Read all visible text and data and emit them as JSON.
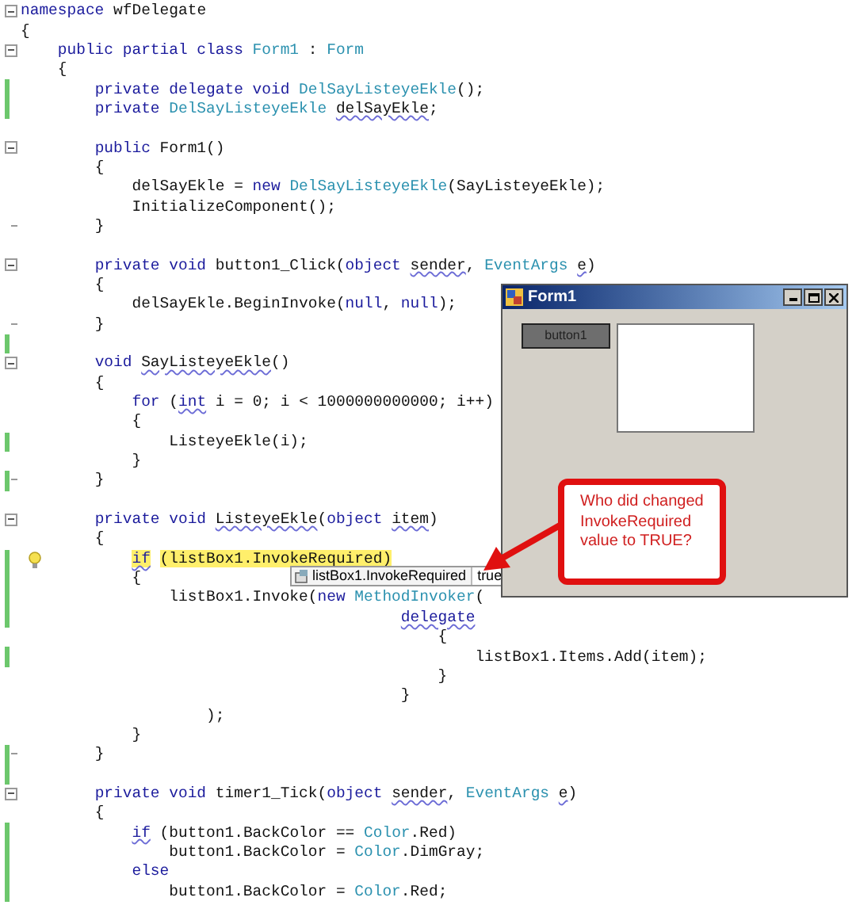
{
  "editor": {
    "lines": [
      {
        "fold": true,
        "end": false,
        "changed": false,
        "tokens": [
          {
            "t": "namespace",
            "kind": "kw"
          },
          {
            "t": " wfDelegate",
            "kind": "plain"
          }
        ]
      },
      {
        "fold": false,
        "end": false,
        "changed": false,
        "tokens": [
          {
            "t": "{",
            "kind": "plain"
          }
        ]
      },
      {
        "fold": true,
        "end": false,
        "changed": false,
        "tokens": [
          {
            "t": "    public partial class ",
            "kind": "kw"
          },
          {
            "t": "Form1",
            "kind": "type"
          },
          {
            "t": " : ",
            "kind": "plain"
          },
          {
            "t": "Form",
            "kind": "type"
          }
        ]
      },
      {
        "fold": false,
        "end": false,
        "changed": false,
        "tokens": [
          {
            "t": "    {",
            "kind": "plain"
          }
        ]
      },
      {
        "fold": false,
        "end": false,
        "changed": true,
        "tokens": [
          {
            "t": "        private delegate void ",
            "kind": "kw"
          },
          {
            "t": "DelSayListeyeEkle",
            "kind": "type"
          },
          {
            "t": "();",
            "kind": "plain"
          }
        ]
      },
      {
        "fold": false,
        "end": false,
        "changed": true,
        "tokens": [
          {
            "t": "        private ",
            "kind": "kw"
          },
          {
            "t": "DelSayListeyeEkle ",
            "kind": "type"
          },
          {
            "t": "delSayEkle",
            "kind": "warn"
          },
          {
            "t": ";",
            "kind": "plain"
          }
        ]
      },
      {
        "fold": false,
        "end": false,
        "changed": false
      },
      {
        "fold": true,
        "end": false,
        "changed": false,
        "tokens": [
          {
            "t": "        public ",
            "kind": "kw"
          },
          {
            "t": "Form1()",
            "kind": "plain"
          }
        ]
      },
      {
        "fold": false,
        "end": false,
        "changed": false,
        "tokens": [
          {
            "t": "        {",
            "kind": "plain"
          }
        ]
      },
      {
        "fold": false,
        "end": false,
        "changed": false,
        "tokens": [
          {
            "t": "            delSayEkle = ",
            "kind": "plain"
          },
          {
            "t": "new ",
            "kind": "kw"
          },
          {
            "t": "DelSayListeyeEkle",
            "kind": "type"
          },
          {
            "t": "(SayListeyeEkle);",
            "kind": "plain"
          }
        ]
      },
      {
        "fold": false,
        "end": false,
        "changed": false,
        "tokens": [
          {
            "t": "            InitializeComponent();",
            "kind": "plain"
          }
        ]
      },
      {
        "fold": false,
        "end": true,
        "changed": false,
        "tokens": [
          {
            "t": "        }",
            "kind": "plain"
          }
        ]
      },
      {
        "fold": false,
        "end": false,
        "changed": false
      },
      {
        "fold": true,
        "end": false,
        "changed": false,
        "tokens": [
          {
            "t": "        private void ",
            "kind": "kw"
          },
          {
            "t": "button1_Click(",
            "kind": "plain"
          },
          {
            "t": "object ",
            "kind": "kw"
          },
          {
            "t": "sender",
            "kind": "warn"
          },
          {
            "t": ", ",
            "kind": "plain"
          },
          {
            "t": "EventArgs ",
            "kind": "type"
          },
          {
            "t": "e",
            "kind": "warn"
          },
          {
            "t": ")",
            "kind": "plain"
          }
        ]
      },
      {
        "fold": false,
        "end": false,
        "changed": false,
        "tokens": [
          {
            "t": "        {",
            "kind": "plain"
          }
        ]
      },
      {
        "fold": false,
        "end": false,
        "changed": false,
        "tokens": [
          {
            "t": "            delSayEkle.BeginInvoke(",
            "kind": "plain"
          },
          {
            "t": "null",
            "kind": "kw"
          },
          {
            "t": ", ",
            "kind": "plain"
          },
          {
            "t": "null",
            "kind": "kw"
          },
          {
            "t": ");",
            "kind": "plain"
          }
        ]
      },
      {
        "fold": false,
        "end": true,
        "changed": false,
        "tokens": [
          {
            "t": "        }",
            "kind": "plain"
          }
        ]
      },
      {
        "fold": false,
        "end": false,
        "changed": true
      },
      {
        "fold": true,
        "end": false,
        "changed": false,
        "tokens": [
          {
            "t": "        void ",
            "kind": "kw"
          },
          {
            "t": "SayListeyeEkle",
            "kind": "warn"
          },
          {
            "t": "()",
            "kind": "plain"
          }
        ]
      },
      {
        "fold": false,
        "end": false,
        "changed": false,
        "tokens": [
          {
            "t": "        {",
            "kind": "plain"
          }
        ]
      },
      {
        "fold": false,
        "end": false,
        "changed": false,
        "tokens": [
          {
            "t": "            for",
            "kind": "kw"
          },
          {
            "t": " (",
            "kind": "plain"
          },
          {
            "t": "int",
            "kind": "kwwarn"
          },
          {
            "t": " i = 0; i < 1000000000000; i++)",
            "kind": "plain"
          }
        ]
      },
      {
        "fold": false,
        "end": false,
        "changed": false,
        "tokens": [
          {
            "t": "            {",
            "kind": "plain"
          }
        ]
      },
      {
        "fold": false,
        "end": false,
        "changed": true,
        "tokens": [
          {
            "t": "                ListeyeEkle(i);",
            "kind": "plain"
          }
        ]
      },
      {
        "fold": false,
        "end": false,
        "changed": false,
        "tokens": [
          {
            "t": "            }",
            "kind": "plain"
          }
        ]
      },
      {
        "fold": false,
        "end": true,
        "changed": true,
        "tokens": [
          {
            "t": "        }",
            "kind": "plain"
          }
        ]
      },
      {
        "fold": false,
        "end": false,
        "changed": false
      },
      {
        "fold": true,
        "end": false,
        "changed": false,
        "tokens": [
          {
            "t": "        private void ",
            "kind": "kw"
          },
          {
            "t": "ListeyeEkle",
            "kind": "warn"
          },
          {
            "t": "(",
            "kind": "plain"
          },
          {
            "t": "object ",
            "kind": "kw"
          },
          {
            "t": "item",
            "kind": "warn"
          },
          {
            "t": ")",
            "kind": "plain"
          }
        ]
      },
      {
        "fold": false,
        "end": false,
        "changed": false,
        "tokens": [
          {
            "t": "        {",
            "kind": "plain"
          }
        ]
      },
      {
        "fold": false,
        "end": false,
        "changed": true,
        "bulb": true,
        "tokens": [
          {
            "t": "            if",
            "kind": "hlkw"
          },
          {
            "t": " (listBox1.InvokeRequired)",
            "kind": "hl"
          }
        ]
      },
      {
        "fold": false,
        "end": false,
        "changed": true,
        "tokens": [
          {
            "t": "            {",
            "kind": "plain"
          }
        ]
      },
      {
        "fold": false,
        "end": false,
        "changed": true,
        "tokens": [
          {
            "t": "                listBox1.Invoke(",
            "kind": "plain"
          },
          {
            "t": "new ",
            "kind": "kw"
          },
          {
            "t": "MethodInvoker",
            "kind": "type"
          },
          {
            "t": "(",
            "kind": "plain"
          }
        ]
      },
      {
        "fold": false,
        "end": false,
        "changed": true,
        "tokens": [
          {
            "t": "                                         delegate",
            "kind": "kwwarn"
          }
        ]
      },
      {
        "fold": false,
        "end": false,
        "changed": false,
        "tokens": [
          {
            "t": "                                             {",
            "kind": "plain"
          }
        ]
      },
      {
        "fold": false,
        "end": false,
        "changed": true,
        "tokens": [
          {
            "t": "                                                 listBox1.Items.Add(item);",
            "kind": "plain"
          }
        ]
      },
      {
        "fold": false,
        "end": false,
        "changed": false,
        "tokens": [
          {
            "t": "                                             }",
            "kind": "plain"
          }
        ]
      },
      {
        "fold": false,
        "end": false,
        "changed": false,
        "tokens": [
          {
            "t": "                                         }",
            "kind": "plain"
          }
        ]
      },
      {
        "fold": false,
        "end": false,
        "changed": false,
        "tokens": [
          {
            "t": "                    );",
            "kind": "plain"
          }
        ]
      },
      {
        "fold": false,
        "end": false,
        "changed": false,
        "tokens": [
          {
            "t": "            }",
            "kind": "plain"
          }
        ]
      },
      {
        "fold": false,
        "end": true,
        "changed": true,
        "tokens": [
          {
            "t": "        }",
            "kind": "plain"
          }
        ]
      },
      {
        "fold": false,
        "end": false,
        "changed": true
      },
      {
        "fold": true,
        "end": false,
        "changed": false,
        "tokens": [
          {
            "t": "        private void ",
            "kind": "kw"
          },
          {
            "t": "timer1_Tick(",
            "kind": "plain"
          },
          {
            "t": "object ",
            "kind": "kw"
          },
          {
            "t": "sender",
            "kind": "warn"
          },
          {
            "t": ", ",
            "kind": "plain"
          },
          {
            "t": "EventArgs ",
            "kind": "type"
          },
          {
            "t": "e",
            "kind": "warn"
          },
          {
            "t": ")",
            "kind": "plain"
          }
        ]
      },
      {
        "fold": false,
        "end": false,
        "changed": false,
        "tokens": [
          {
            "t": "        {",
            "kind": "plain"
          }
        ]
      },
      {
        "fold": false,
        "end": false,
        "changed": true,
        "tokens": [
          {
            "t": "            if",
            "kind": "kwwarn"
          },
          {
            "t": " (button1.BackColor == ",
            "kind": "plain"
          },
          {
            "t": "Color",
            "kind": "type"
          },
          {
            "t": ".Red)",
            "kind": "plain"
          }
        ]
      },
      {
        "fold": false,
        "end": false,
        "changed": true,
        "tokens": [
          {
            "t": "                button1.BackColor = ",
            "kind": "plain"
          },
          {
            "t": "Color",
            "kind": "type"
          },
          {
            "t": ".DimGray;",
            "kind": "plain"
          }
        ]
      },
      {
        "fold": false,
        "end": false,
        "changed": true,
        "tokens": [
          {
            "t": "            else",
            "kind": "kw"
          }
        ]
      },
      {
        "fold": false,
        "end": false,
        "changed": true,
        "tokens": [
          {
            "t": "                button1.BackColor = ",
            "kind": "plain"
          },
          {
            "t": "Color",
            "kind": "type"
          },
          {
            "t": ".Red;",
            "kind": "plain"
          }
        ]
      }
    ]
  },
  "datatip": {
    "expression": "listBox1.InvokeRequired",
    "value": "true"
  },
  "form_window": {
    "title": "Form1",
    "button": "button1"
  },
  "callout": {
    "text": "Who did changed InvokeRequired value to TRUE?"
  }
}
